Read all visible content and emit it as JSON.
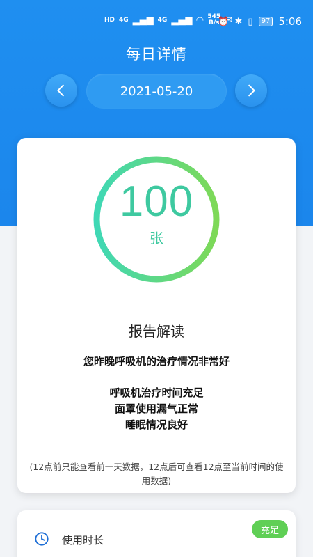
{
  "status_bar": {
    "net_speed_value": "545",
    "net_speed_unit": "B/s",
    "battery": "97",
    "time": "5:06",
    "sim_labels": [
      "HD",
      "HD"
    ],
    "signal_labels": [
      "4G",
      "4G"
    ]
  },
  "header": {
    "title": "每日详情",
    "date": "2021-05-20"
  },
  "summary": {
    "value": "100",
    "unit": "张",
    "ring_progress": 1.0,
    "ring_colors": [
      "#3fd8b5",
      "#7ed957"
    ]
  },
  "report": {
    "title": "报告解读",
    "lines": [
      "您昨晚呼吸机的治疗情况非常好",
      "呼吸机治疗时间充足",
      "面罩使用漏气正常",
      "睡眠情况良好"
    ],
    "note": "(12点前只能查看前一天数据，12点后可查看12点至当前时间的使用数据)"
  },
  "usage": {
    "label": "使用时长",
    "badge": "充足"
  },
  "colors": {
    "primary": "#1f8ff0",
    "accent_green": "#3ec9a0",
    "badge_green": "#5fcf55"
  }
}
